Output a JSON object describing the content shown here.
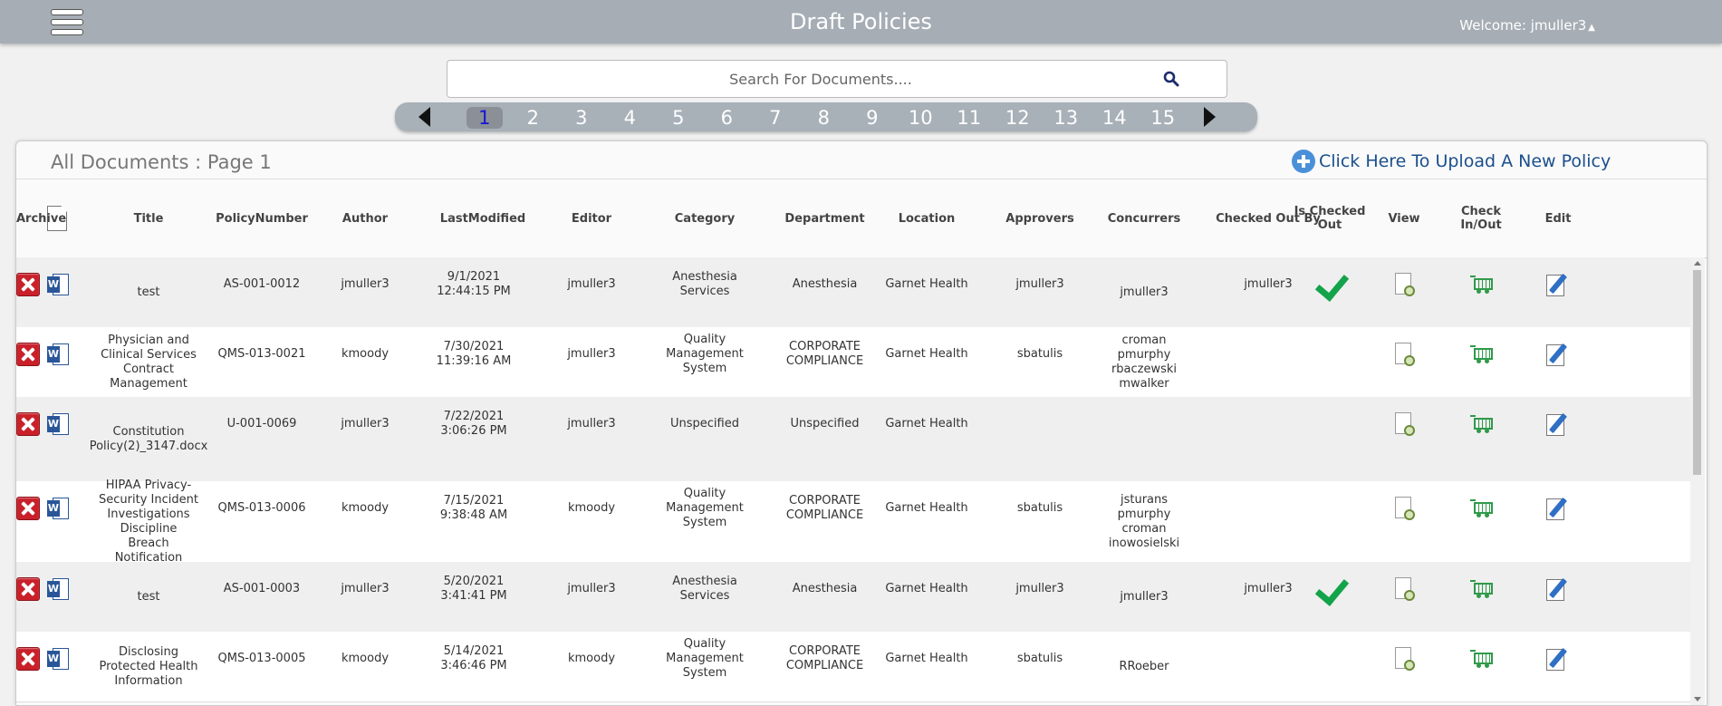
{
  "header": {
    "title": "Draft Policies",
    "welcome": "Welcome: jmuller3"
  },
  "search": {
    "placeholder": "Search For Documents...."
  },
  "pagination": {
    "pages": [
      "1",
      "2",
      "3",
      "4",
      "5",
      "6",
      "7",
      "8",
      "9",
      "10",
      "11",
      "12",
      "13",
      "14",
      "15"
    ],
    "active_page": "1"
  },
  "panel": {
    "title": "All Documents : Page 1",
    "upload_label": "Click Here To Upload A New Policy"
  },
  "columns": [
    "Title",
    "PolicyNumber",
    "Author",
    "LastModified",
    "Editor",
    "Category",
    "Department",
    "Location",
    "Approvers",
    "Concurrers",
    "Checked Out By",
    "Is Checked Out",
    "View",
    "Check In/Out",
    "Edit",
    "Archive"
  ],
  "rows": [
    {
      "title": "test",
      "policy": "AS-001-0012",
      "author": "jmuller3",
      "modified": "9/1/2021 12:44:15 PM",
      "editor": "jmuller3",
      "category": "Anesthesia Services",
      "department": "Anesthesia",
      "location": "Garnet Health",
      "approvers": "jmuller3",
      "concurrers": "jmuller3",
      "checked_out_by": "jmuller3",
      "checked_out": true
    },
    {
      "title": "Physician and Clinical Services Contract Management",
      "policy": "QMS-013-0021",
      "author": "kmoody",
      "modified": "7/30/2021 11:39:16 AM",
      "editor": "jmuller3",
      "category": "Quality Management System",
      "department": "CORPORATE COMPLIANCE",
      "location": "Garnet Health",
      "approvers": "sbatulis",
      "concurrers": "croman pmurphy rbaczewski mwalker",
      "checked_out_by": "",
      "checked_out": false
    },
    {
      "title": "Constitution Policy(2)_3147.docx",
      "policy": "U-001-0069",
      "author": "jmuller3",
      "modified": "7/22/2021 3:06:26 PM",
      "editor": "jmuller3",
      "category": "Unspecified",
      "department": "Unspecified",
      "location": "Garnet Health",
      "approvers": "",
      "concurrers": "",
      "checked_out_by": "",
      "checked_out": false
    },
    {
      "title": "HIPAA Privacy-Security Incident Investigations Discipline Breach Notification",
      "policy": "QMS-013-0006",
      "author": "kmoody",
      "modified": "7/15/2021 9:38:48 AM",
      "editor": "kmoody",
      "category": "Quality Management System",
      "department": "CORPORATE COMPLIANCE",
      "location": "Garnet Health",
      "approvers": "sbatulis",
      "concurrers": "jsturans pmurphy croman inowosielski",
      "checked_out_by": "",
      "checked_out": false
    },
    {
      "title": "test",
      "policy": "AS-001-0003",
      "author": "jmuller3",
      "modified": "5/20/2021 3:41:41 PM",
      "editor": "jmuller3",
      "category": "Anesthesia Services",
      "department": "Anesthesia",
      "location": "Garnet Health",
      "approvers": "jmuller3",
      "concurrers": "jmuller3",
      "checked_out_by": "jmuller3",
      "checked_out": true
    },
    {
      "title": "Disclosing Protected Health Information",
      "policy": "QMS-013-0005",
      "author": "kmoody",
      "modified": "5/14/2021 3:46:46 PM",
      "editor": "kmoody",
      "category": "Quality Management System",
      "department": "CORPORATE COMPLIANCE",
      "location": "Garnet Health",
      "approvers": "sbatulis",
      "concurrers": "RRoeber",
      "checked_out_by": "",
      "checked_out": false
    }
  ]
}
